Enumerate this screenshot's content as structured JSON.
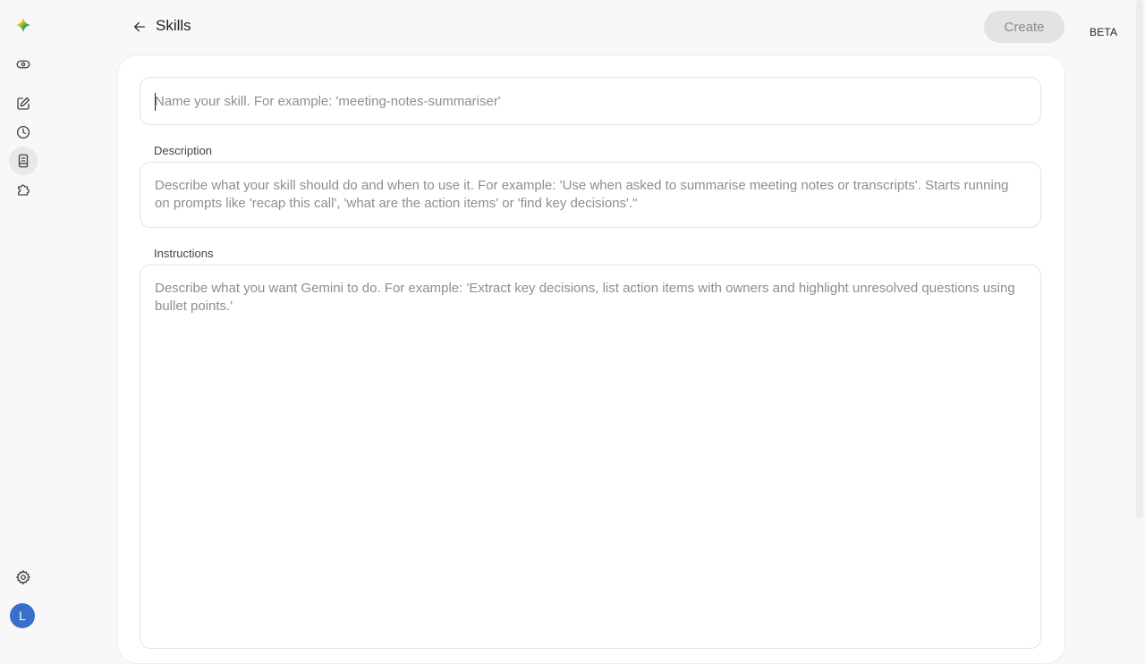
{
  "rail": {
    "items": [
      {
        "icon": "gemini-spark-icon"
      },
      {
        "icon": "toggle-icon"
      },
      {
        "icon": "new-chat-icon"
      },
      {
        "icon": "history-icon"
      },
      {
        "icon": "skills-icon"
      },
      {
        "icon": "extensions-icon"
      },
      {
        "icon": "settings-icon"
      }
    ],
    "avatar_initial": "L",
    "avatar_color": "#3a6fc9"
  },
  "header": {
    "title": "Skills",
    "create_label": "Create",
    "beta_label": "BETA"
  },
  "form": {
    "name": {
      "placeholder": "Name your skill. For example: 'meeting-notes-summariser'",
      "value": ""
    },
    "description": {
      "label": "Description",
      "placeholder": "Describe what your skill should do and when to use it. For example: 'Use when asked to summarise meeting notes or transcripts'. Starts running on prompts like 'recap this call', 'what are the action items' or 'find key decisions'.\"",
      "value": ""
    },
    "instructions": {
      "label": "Instructions",
      "placeholder": "Describe what you want Gemini to do. For example: 'Extract key decisions, list action items with owners and highlight unresolved questions using bullet points.'",
      "value": ""
    }
  }
}
